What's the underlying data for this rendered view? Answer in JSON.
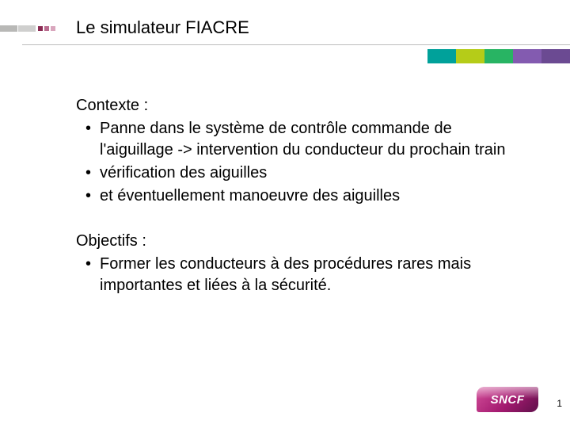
{
  "title": "Le simulateur FIACRE",
  "context": {
    "heading": "Contexte :",
    "bullets": [
      "Panne dans le système de contrôle commande de l'aiguillage -> intervention du conducteur du prochain train",
      "vérification des aiguilles",
      "et éventuellement manoeuvre des aiguilles"
    ]
  },
  "objectives": {
    "heading": "Objectifs :",
    "bullets": [
      "Former les conducteurs à des procédures rares mais importantes et liées à la sécurité."
    ]
  },
  "brand": {
    "logo_text": "SNCF",
    "strip_colors": [
      "#00a19a",
      "#b5cc18",
      "#28b463",
      "#835bb0",
      "#6b4a92"
    ]
  },
  "page_number": "1"
}
